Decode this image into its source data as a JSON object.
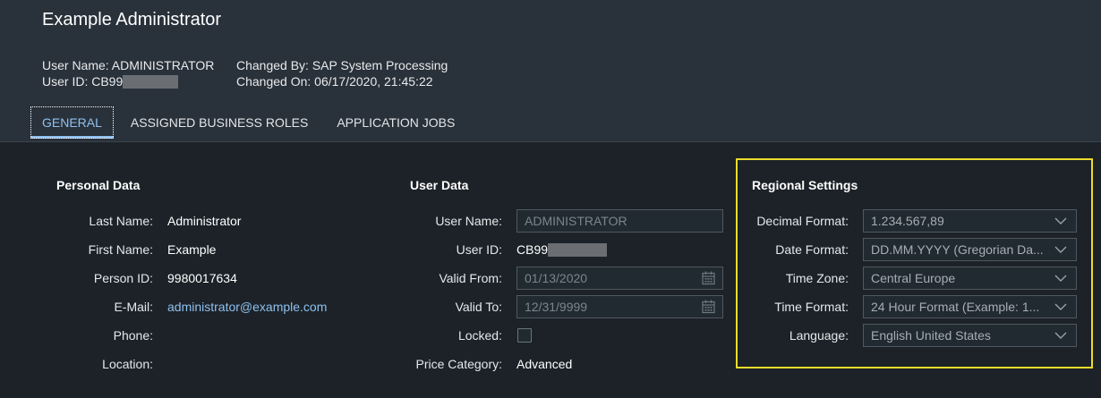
{
  "header": {
    "title": "Example Administrator",
    "user_name": "User Name: ADMINISTRATOR",
    "user_id": "User ID: CB99",
    "changed_by": "Changed By: SAP System Processing",
    "changed_on": "Changed On: 06/17/2020, 21:45:22"
  },
  "tabs": [
    {
      "label": "GENERAL",
      "active": true
    },
    {
      "label": "ASSIGNED BUSINESS ROLES",
      "active": false
    },
    {
      "label": "APPLICATION JOBS",
      "active": false
    }
  ],
  "personal": {
    "title": "Personal Data",
    "fields": [
      {
        "label": "Last Name:",
        "value": "Administrator"
      },
      {
        "label": "First Name:",
        "value": "Example"
      },
      {
        "label": "Person ID:",
        "value": "9980017634"
      },
      {
        "label": "E-Mail:",
        "value": "administrator@example.com"
      },
      {
        "label": "Phone:",
        "value": ""
      },
      {
        "label": "Location:",
        "value": ""
      }
    ]
  },
  "user": {
    "title": "User Data",
    "user_name_label": "User Name:",
    "user_name_value": "ADMINISTRATOR",
    "user_id_label": "User ID:",
    "user_id_value": "CB99",
    "valid_from_label": "Valid From:",
    "valid_from_value": "01/13/2020",
    "valid_to_label": "Valid To:",
    "valid_to_value": "12/31/9999",
    "locked_label": "Locked:",
    "price_label": "Price Category:",
    "price_value": "Advanced"
  },
  "regional": {
    "title": "Regional Settings",
    "fields": [
      {
        "label": "Decimal Format:",
        "value": "1.234.567,89"
      },
      {
        "label": "Date Format:",
        "value": "DD.MM.YYYY (Gregorian Da..."
      },
      {
        "label": "Time Zone:",
        "value": "Central Europe"
      },
      {
        "label": "Time Format:",
        "value": "24 Hour Format (Example: 1..."
      },
      {
        "label": "Language:",
        "value": "English United States"
      }
    ]
  },
  "colors": {
    "accent": "#8fc0ef",
    "highlight": "#ecdc2c",
    "background": "#1c2228",
    "header_background": "#29313a"
  },
  "icons": {
    "calendar": "calendar-icon",
    "dropdown": "chevron-down-icon"
  }
}
